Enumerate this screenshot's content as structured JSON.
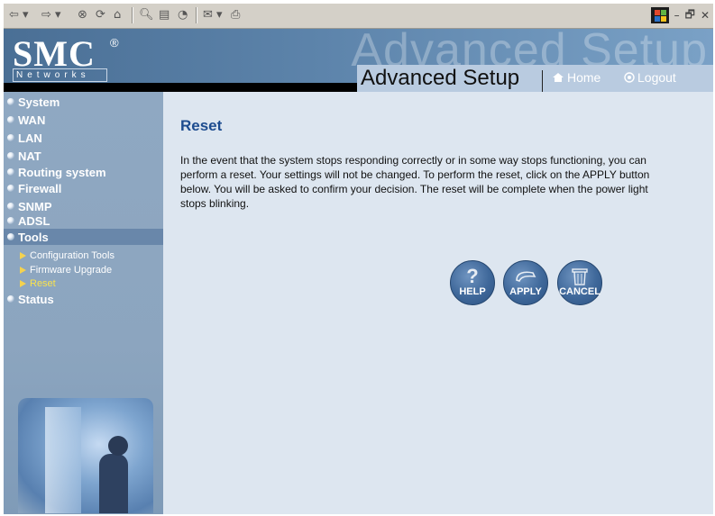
{
  "header": {
    "brand": "SMC",
    "brand_mark": "®",
    "brand_sub": "Networks",
    "watermark": "Advanced Setup",
    "title": "Advanced Setup",
    "home": "Home",
    "logout": "Logout"
  },
  "sidebar": {
    "items": [
      "System",
      "WAN",
      "LAN",
      "NAT",
      "Routing system",
      "Firewall",
      "SNMP",
      "ADSL",
      "Tools",
      "Status"
    ],
    "tools_sub": [
      "Configuration Tools",
      "Firmware Upgrade",
      "Reset"
    ]
  },
  "main": {
    "title": "Reset",
    "desc": "In the event that the system stops responding correctly or in some way stops functioning, you can perform a reset. Your settings will not be changed. To perform the reset, click on the APPLY button below. You will be asked to confirm your decision. The reset will be complete when the power light stops blinking.",
    "buttons": {
      "help": "HELP",
      "apply": "APPLY",
      "cancel": "CANCEL"
    }
  },
  "icons": [
    "back-icon",
    "forward-icon",
    "stop-icon",
    "refresh-icon",
    "home-icon",
    "search-icon",
    "favorites-icon",
    "history-icon",
    "mail-icon",
    "print-icon",
    "windows-logo-icon",
    "minimize-icon",
    "restore-icon",
    "close-icon",
    "nav-bullet-icon",
    "submenu-arrow-icon",
    "question-icon",
    "apply-icon",
    "trash-icon",
    "logout-icon"
  ],
  "colors": {
    "accent": "#1d4c8f",
    "sidebar": "#8fa8c2",
    "current_sub": "#f9e34d"
  }
}
